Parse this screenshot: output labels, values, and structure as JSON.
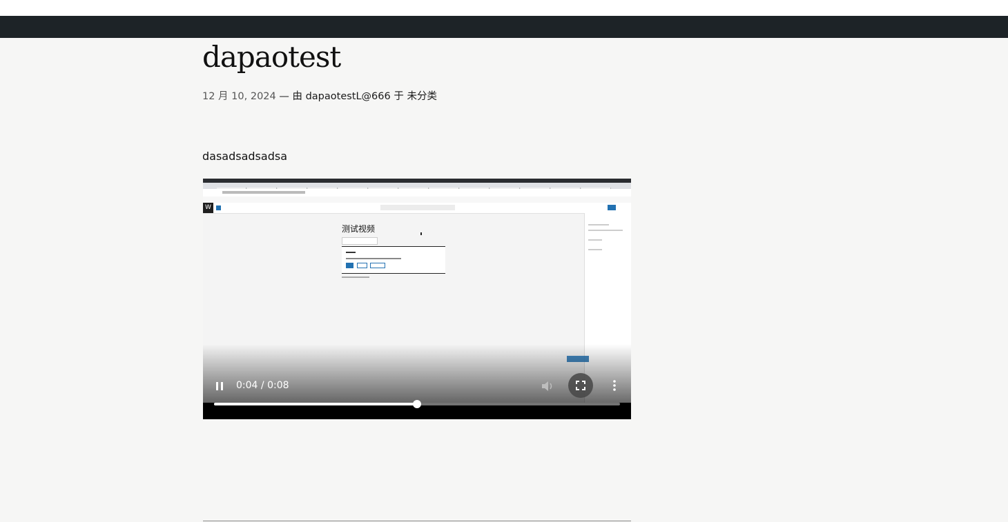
{
  "post": {
    "title": "dapaotest",
    "date": "12 月 10, 2024",
    "by_prefix": "— 由",
    "author": "dapaotestL@666",
    "in_word": "于",
    "category": "未分类",
    "paragraph": "dasadsadsadsa"
  },
  "video": {
    "current_time": "0:04",
    "separator": " / ",
    "duration": "0:08",
    "progress": 0.5,
    "frame_title": "测试视频",
    "state": "playing",
    "icons": [
      "pause-icon",
      "volume-icon",
      "fullscreen-icon",
      "more-options-icon"
    ]
  },
  "colors": {
    "admin_bar": "#1d2327",
    "page_bg": "#f6f6f5",
    "video_bg": "#000000"
  }
}
